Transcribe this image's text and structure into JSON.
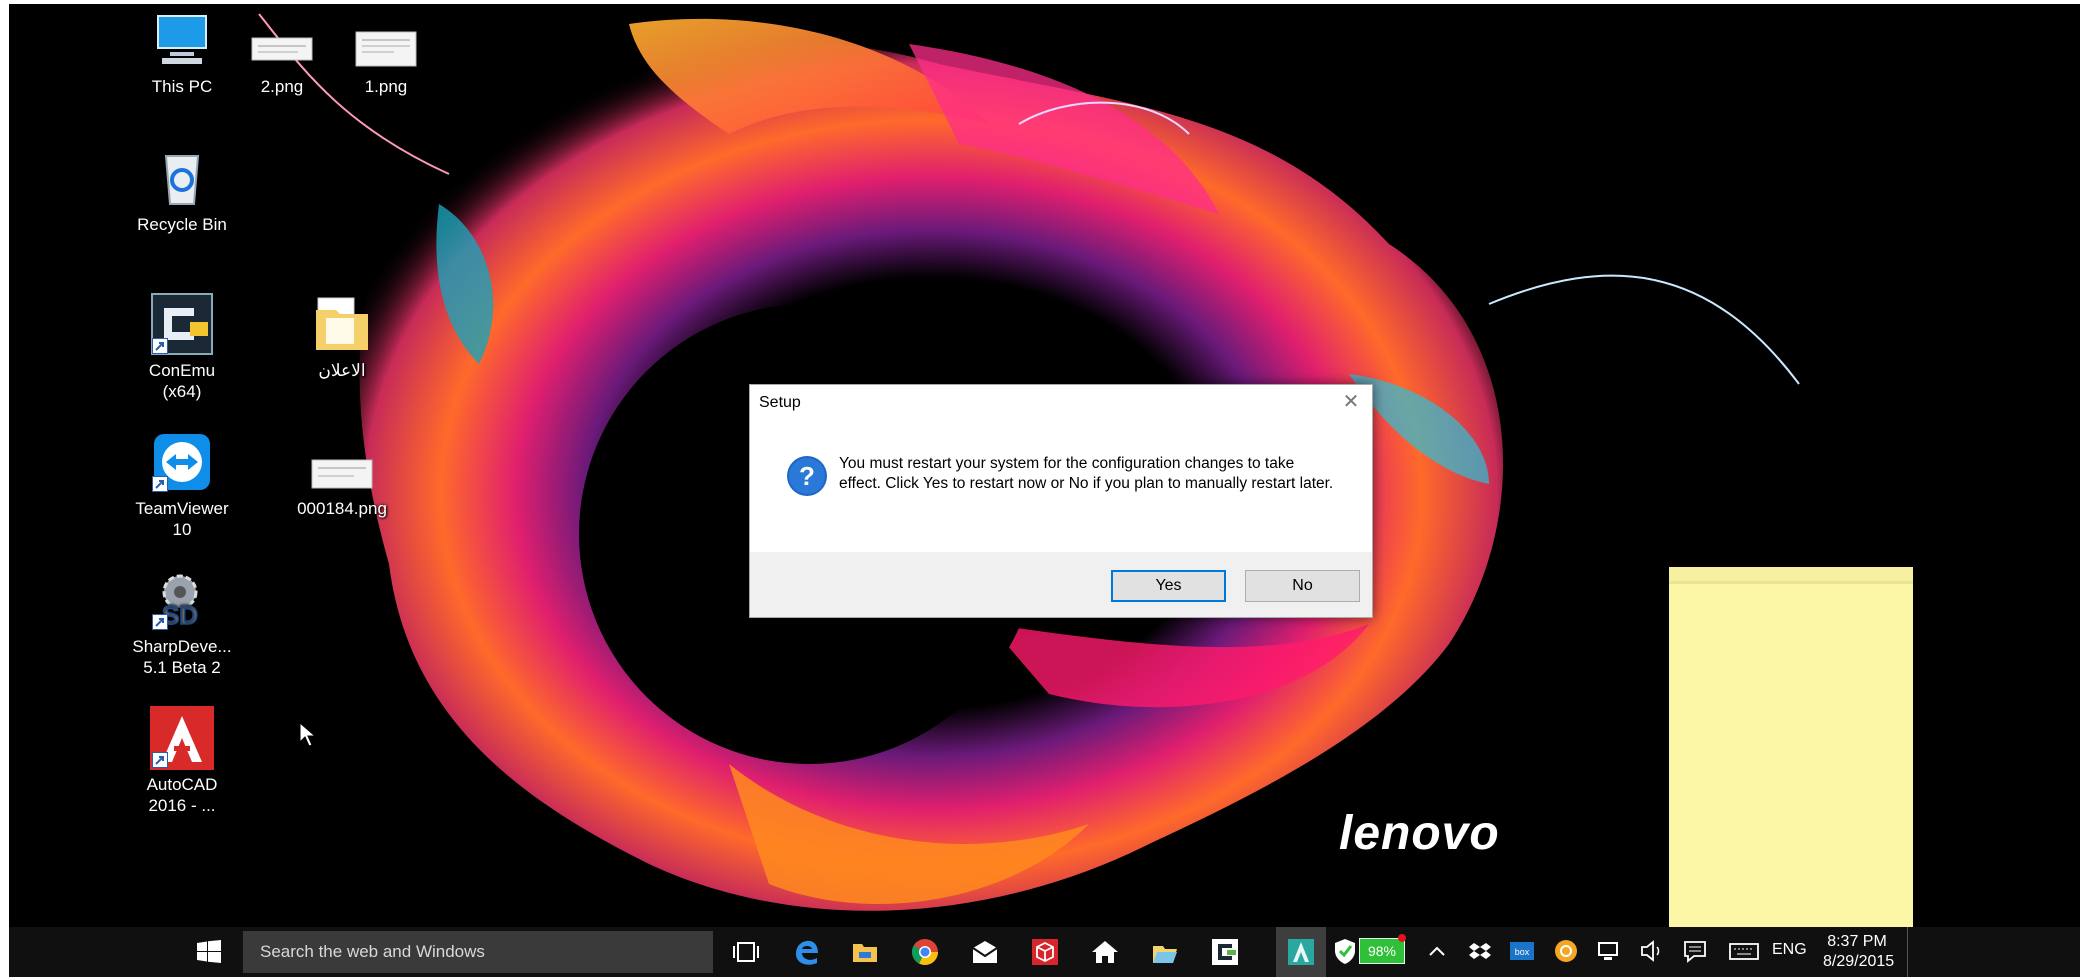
{
  "desktop": {
    "icons": [
      {
        "label": "This PC",
        "icon": "computer-icon"
      },
      {
        "label": "2.png",
        "icon": "image-file-icon"
      },
      {
        "label": "1.png",
        "icon": "image-file-icon"
      },
      {
        "label": "Recycle Bin",
        "icon": "recycle-bin-icon"
      },
      {
        "label": "ConEmu (x64)",
        "icon": "terminal-icon"
      },
      {
        "label": "الاعلان",
        "icon": "folder-icon"
      },
      {
        "label": "TeamViewer\n10",
        "icon": "teamviewer-icon"
      },
      {
        "label": "000184.png",
        "icon": "image-file-icon"
      },
      {
        "label": "SharpDeve...\n5.1 Beta 2",
        "icon": "sharpdevelop-icon"
      },
      {
        "label": "AutoCAD\n2016 - ...",
        "icon": "autocad-icon"
      }
    ],
    "wallpaper_brand": "lenovo"
  },
  "dialog": {
    "title": "Setup",
    "message": "You must restart your system for the configuration changes to take effect. Click Yes to restart now or No if you plan to manually restart later.",
    "icon": "question-icon",
    "yes_label": "Yes",
    "no_label": "No",
    "close_glyph": "✕"
  },
  "taskbar": {
    "search_placeholder": "Search the web and Windows",
    "pinned": [
      "task-view-icon",
      "edge-icon",
      "file-explorer-icon",
      "chrome-icon",
      "mail-icon",
      "package-icon",
      "home-icon",
      "folder-icon",
      "conemu-icon",
      "autocad-icon"
    ],
    "battery": "98%",
    "language": "ENG",
    "time": "8:37 PM",
    "date": "8/29/2015"
  },
  "colors": {
    "accent": "#0078d7",
    "taskbar": "#101010",
    "sticky_note": "#fbf7a7",
    "battery": "#2fbf38"
  }
}
